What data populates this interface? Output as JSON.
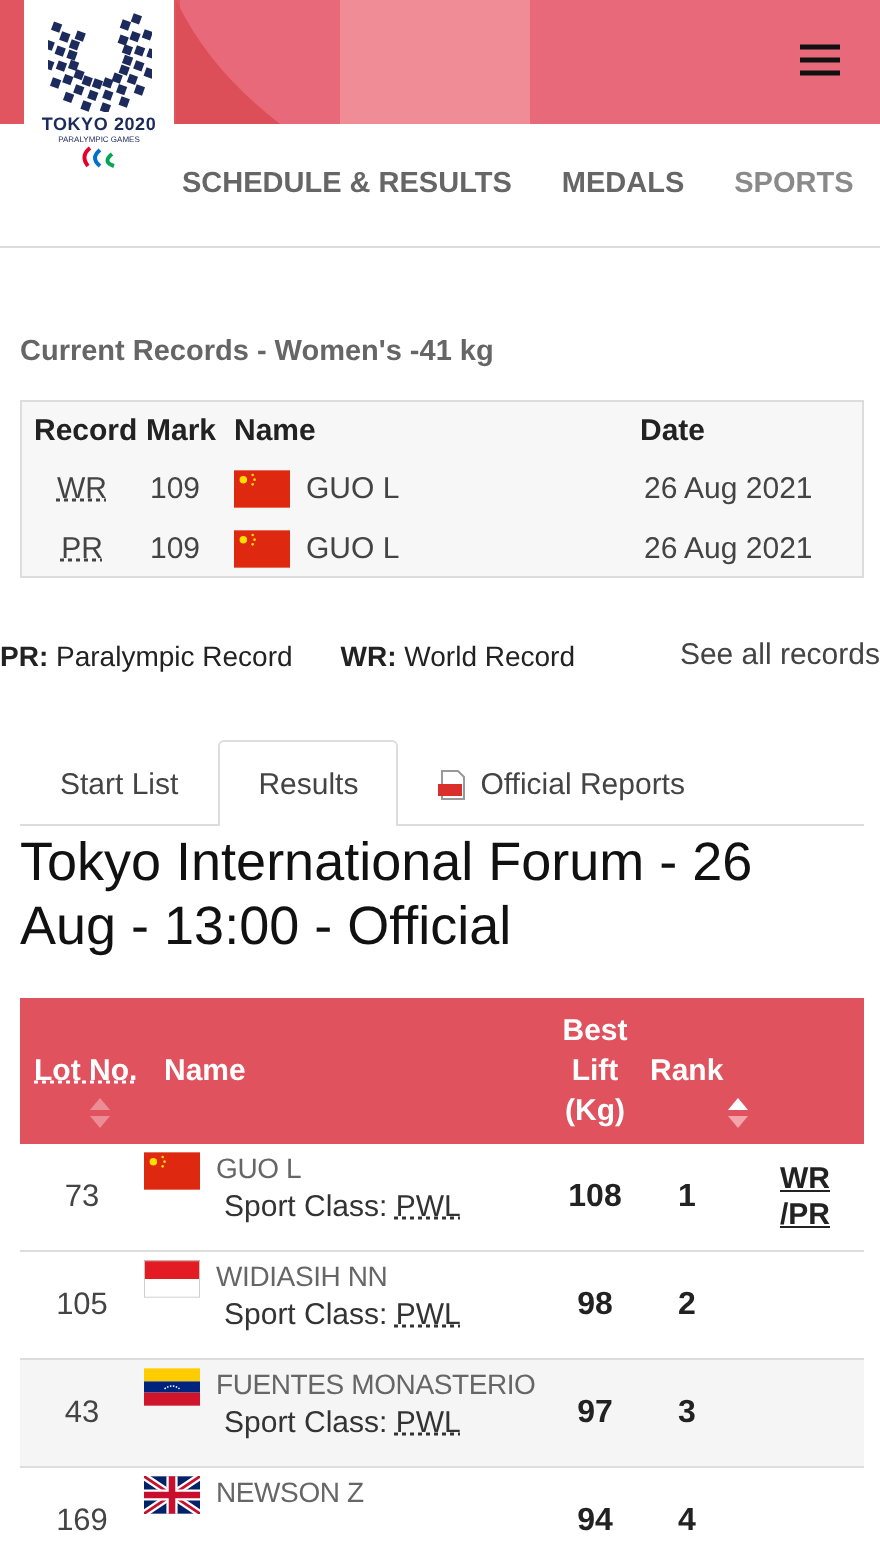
{
  "header": {
    "logo_text": "TOKYO 2020",
    "logo_subtext": "PARALYMPIC GAMES",
    "nav": [
      "SCHEDULE & RESULTS",
      "MEDALS",
      "SPORTS"
    ]
  },
  "records": {
    "title": "Current Records - Women's -41 kg",
    "columns": [
      "Record",
      "Mark",
      "Name",
      "Date"
    ],
    "rows": [
      {
        "record": "WR",
        "mark": "109",
        "kind": "china",
        "name": "GUO L",
        "date": "26 Aug 2021"
      },
      {
        "record": "PR",
        "mark": "109",
        "kind": "china",
        "name": "GUO L",
        "date": "26 Aug 2021"
      }
    ],
    "legend": [
      {
        "abbr": "PR:",
        "text": "Paralympic Record"
      },
      {
        "abbr": "WR:",
        "text": "World Record"
      }
    ],
    "see_all": "See all records"
  },
  "tabs": [
    {
      "label": "Start List",
      "selected": false,
      "kind": "text"
    },
    {
      "label": "Results",
      "selected": true,
      "kind": "text"
    },
    {
      "label": "Official Reports",
      "selected": false,
      "kind": "pdf"
    }
  ],
  "results": {
    "heading": "Tokyo International Forum - 26 Aug - 13:00 - Official",
    "columns": [
      {
        "label": "Lot No.",
        "sorted": false
      },
      {
        "label": "Name"
      },
      {
        "label": "Best Lift (Kg)"
      },
      {
        "label": "Rank",
        "sorted": true
      }
    ],
    "rows": [
      {
        "lot": "73",
        "kind": "china",
        "name": "GUO L",
        "class_label": "Sport Class:",
        "sport_class": "PWL",
        "lift": "108",
        "rank": "1",
        "records": [
          "WR",
          "/PR"
        ]
      },
      {
        "lot": "105",
        "kind": "indonesia",
        "name": "WIDIASIH NN",
        "class_label": "Sport Class:",
        "sport_class": "PWL",
        "lift": "98",
        "rank": "2",
        "records": []
      },
      {
        "lot": "43",
        "kind": "venezuela",
        "name": "FUENTES MONASTERIO",
        "class_label": "Sport Class:",
        "sport_class": "PWL",
        "lift": "97",
        "rank": "3",
        "records": []
      },
      {
        "lot": "169",
        "kind": "uk",
        "name": "NEWSON Z",
        "lift": "94",
        "rank": "4",
        "records": []
      }
    ]
  }
}
